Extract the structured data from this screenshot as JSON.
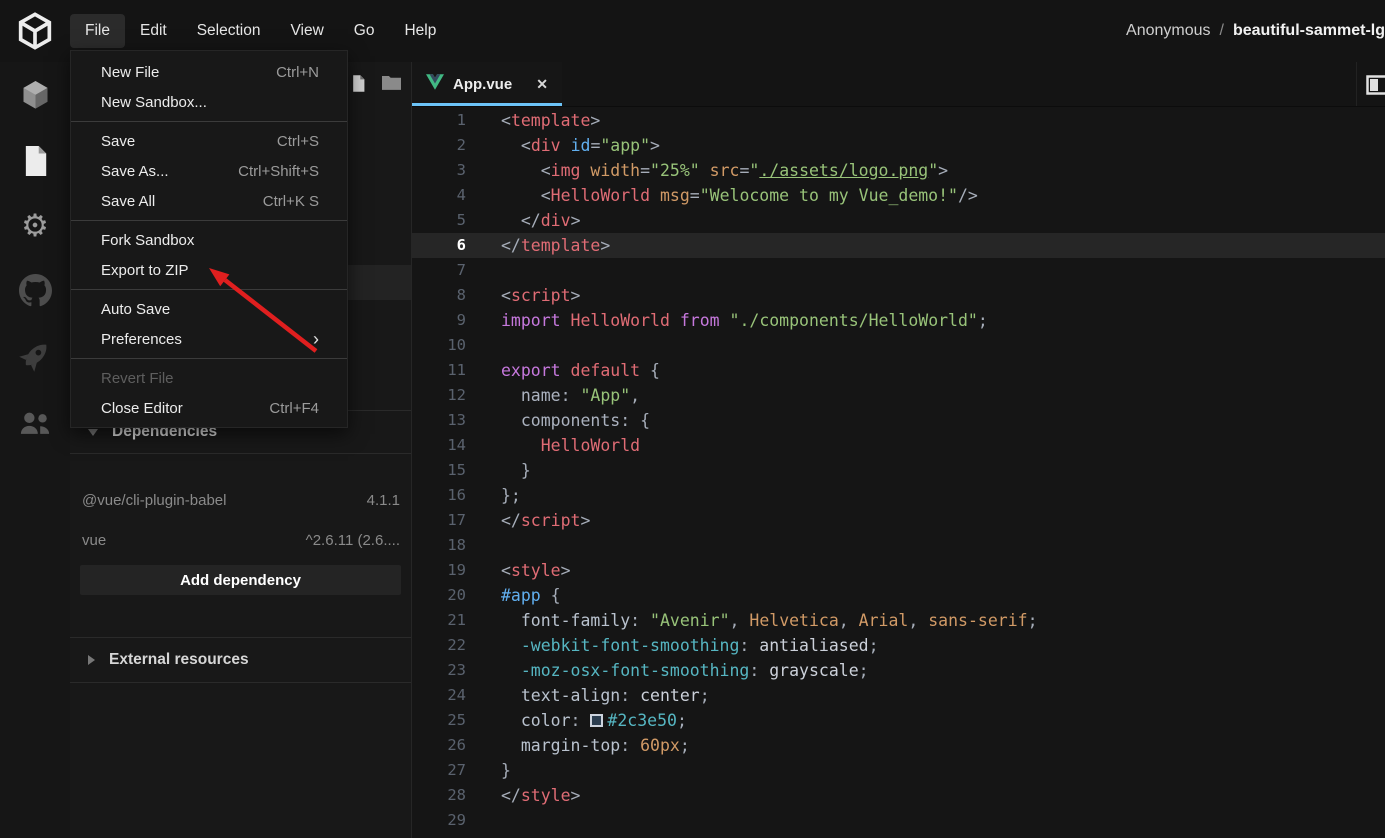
{
  "topbar": {
    "menus": [
      "File",
      "Edit",
      "Selection",
      "View",
      "Go",
      "Help"
    ],
    "active_menu": "File",
    "user": "Anonymous",
    "separator": "/",
    "sandbox_name": "beautiful-sammet-lg"
  },
  "activity_bar": {
    "items": [
      {
        "icon": "sandbox-cube-icon",
        "active": false
      },
      {
        "icon": "files-icon",
        "active": true
      },
      {
        "icon": "settings-gear-icon",
        "active": false
      },
      {
        "icon": "github-icon",
        "active": false
      },
      {
        "icon": "rocket-icon",
        "active": false
      },
      {
        "icon": "live-users-icon",
        "active": false
      }
    ]
  },
  "file_menu": {
    "items": [
      {
        "label": "New File",
        "shortcut": "Ctrl+N"
      },
      {
        "label": "New Sandbox...",
        "shortcut": ""
      },
      {
        "type": "separator"
      },
      {
        "label": "Save",
        "shortcut": "Ctrl+S"
      },
      {
        "label": "Save As...",
        "shortcut": "Ctrl+Shift+S"
      },
      {
        "label": "Save All",
        "shortcut": "Ctrl+K S"
      },
      {
        "type": "separator"
      },
      {
        "label": "Fork Sandbox",
        "shortcut": ""
      },
      {
        "label": "Export to ZIP",
        "shortcut": "",
        "annotated": true
      },
      {
        "type": "separator"
      },
      {
        "label": "Auto Save",
        "shortcut": ""
      },
      {
        "label": "Preferences",
        "shortcut": "",
        "submenu": true
      },
      {
        "type": "separator"
      },
      {
        "label": "Revert File",
        "shortcut": "",
        "disabled": true
      },
      {
        "label": "Close Editor",
        "shortcut": "Ctrl+F4"
      }
    ]
  },
  "explorer": {
    "dependencies_title": "Dependencies",
    "dependencies": [
      {
        "name": "@vue/cli-plugin-babel",
        "version": "4.1.1"
      },
      {
        "name": "vue",
        "version": "^2.6.11 (2.6...."
      }
    ],
    "add_dependency_label": "Add dependency",
    "external_resources_title": "External resources"
  },
  "editor": {
    "tab": {
      "label": "App.vue",
      "icon": "vue-logo-icon",
      "close_glyph": "✕"
    },
    "active_line": 6,
    "code_lines": [
      [
        [
          "<",
          "pn"
        ],
        [
          "template",
          "tag"
        ],
        [
          ">",
          "pn"
        ]
      ],
      [
        [
          "  <",
          "pn"
        ],
        [
          "div",
          "tag"
        ],
        [
          " ",
          "pn"
        ],
        [
          "id",
          "attrb"
        ],
        [
          "=",
          "pn"
        ],
        [
          "\"app\"",
          "str"
        ],
        [
          ">",
          "pn"
        ]
      ],
      [
        [
          "    <",
          "pn"
        ],
        [
          "img",
          "tag"
        ],
        [
          " ",
          "pn"
        ],
        [
          "width",
          "attro"
        ],
        [
          "=",
          "pn"
        ],
        [
          "\"25%\"",
          "str"
        ],
        [
          " ",
          "pn"
        ],
        [
          "src",
          "attro"
        ],
        [
          "=",
          "pn"
        ],
        [
          "\"",
          "str"
        ],
        [
          "./assets/logo.png",
          "strl"
        ],
        [
          "\"",
          "str"
        ],
        [
          ">",
          "pn"
        ]
      ],
      [
        [
          "    <",
          "pn"
        ],
        [
          "HelloWorld",
          "tag"
        ],
        [
          " ",
          "pn"
        ],
        [
          "msg",
          "attro"
        ],
        [
          "=",
          "pn"
        ],
        [
          "\"Welocome to my Vue_demo!\"",
          "str"
        ],
        [
          "/>",
          "pn"
        ]
      ],
      [
        [
          "  </",
          "pn"
        ],
        [
          "div",
          "tag"
        ],
        [
          ">",
          "pn"
        ]
      ],
      [
        [
          "</",
          "pn"
        ],
        [
          "template",
          "tag"
        ],
        [
          ">",
          "pn"
        ]
      ],
      [],
      [
        [
          "<",
          "pn"
        ],
        [
          "script",
          "tag"
        ],
        [
          ">",
          "pn"
        ]
      ],
      [
        [
          "import",
          "kw"
        ],
        [
          " ",
          "pn"
        ],
        [
          "HelloWorld",
          "kwr"
        ],
        [
          " ",
          "pn"
        ],
        [
          "from",
          "kw"
        ],
        [
          " ",
          "pn"
        ],
        [
          "\"./components/HelloWorld\"",
          "str"
        ],
        [
          ";",
          "pn"
        ]
      ],
      [],
      [
        [
          "export",
          "kw"
        ],
        [
          " ",
          "pn"
        ],
        [
          "default",
          "kwr"
        ],
        [
          " {",
          "pn"
        ]
      ],
      [
        [
          "  ",
          "pn"
        ],
        [
          "name",
          "id"
        ],
        [
          ": ",
          "pn"
        ],
        [
          "\"App\"",
          "str"
        ],
        [
          ",",
          "pn"
        ]
      ],
      [
        [
          "  ",
          "pn"
        ],
        [
          "components",
          "id"
        ],
        [
          ": {",
          "pn"
        ]
      ],
      [
        [
          "    ",
          "pn"
        ],
        [
          "HelloWorld",
          "kwr"
        ]
      ],
      [
        [
          "  }",
          "pn"
        ]
      ],
      [
        [
          "};",
          "pn"
        ]
      ],
      [
        [
          "</",
          "pn"
        ],
        [
          "script",
          "tag"
        ],
        [
          ">",
          "pn"
        ]
      ],
      [],
      [
        [
          "<",
          "pn"
        ],
        [
          "style",
          "tag"
        ],
        [
          ">",
          "pn"
        ]
      ],
      [
        [
          "#app",
          "attrb"
        ],
        [
          " {",
          "pn"
        ]
      ],
      [
        [
          "  ",
          "pn"
        ],
        [
          "font-family",
          "prop"
        ],
        [
          ": ",
          "pn"
        ],
        [
          "\"Avenir\"",
          "str"
        ],
        [
          ", ",
          "pn"
        ],
        [
          "Helvetica",
          "attro"
        ],
        [
          ", ",
          "pn"
        ],
        [
          "Arial",
          "attro"
        ],
        [
          ", ",
          "pn"
        ],
        [
          "sans-serif",
          "attro"
        ],
        [
          ";",
          "pn"
        ]
      ],
      [
        [
          "  ",
          "pn"
        ],
        [
          "-webkit-font-smoothing",
          "propv"
        ],
        [
          ": ",
          "pn"
        ],
        [
          "antialiased",
          "val"
        ],
        [
          ";",
          "pn"
        ]
      ],
      [
        [
          "  ",
          "pn"
        ],
        [
          "-moz-osx-font-smoothing",
          "propv"
        ],
        [
          ": ",
          "pn"
        ],
        [
          "grayscale",
          "val"
        ],
        [
          ";",
          "pn"
        ]
      ],
      [
        [
          "  ",
          "pn"
        ],
        [
          "text-align",
          "prop"
        ],
        [
          ": ",
          "pn"
        ],
        [
          "center",
          "val"
        ],
        [
          ";",
          "pn"
        ]
      ],
      [
        [
          "  ",
          "pn"
        ],
        [
          "color",
          "prop"
        ],
        [
          ": ",
          "pn"
        ],
        [
          "",
          "swatch"
        ],
        [
          "#2c3e50",
          "hex"
        ],
        [
          ";",
          "pn"
        ]
      ],
      [
        [
          "  ",
          "pn"
        ],
        [
          "margin-top",
          "prop"
        ],
        [
          ": ",
          "pn"
        ],
        [
          "60px",
          "num"
        ],
        [
          ";",
          "pn"
        ]
      ],
      [
        [
          "}",
          "pn"
        ]
      ],
      [
        [
          "</",
          "pn"
        ],
        [
          "style",
          "tag"
        ],
        [
          ">",
          "pn"
        ]
      ],
      []
    ]
  },
  "colors": {
    "accent_tab_underline": "#6cc3f7",
    "vue_green": "#41b883",
    "vue_dark": "#34495e",
    "annotation_arrow_red": "#e01f1f",
    "css_swatch_value": "#2c3e50",
    "current_line_bg": "#262626"
  }
}
